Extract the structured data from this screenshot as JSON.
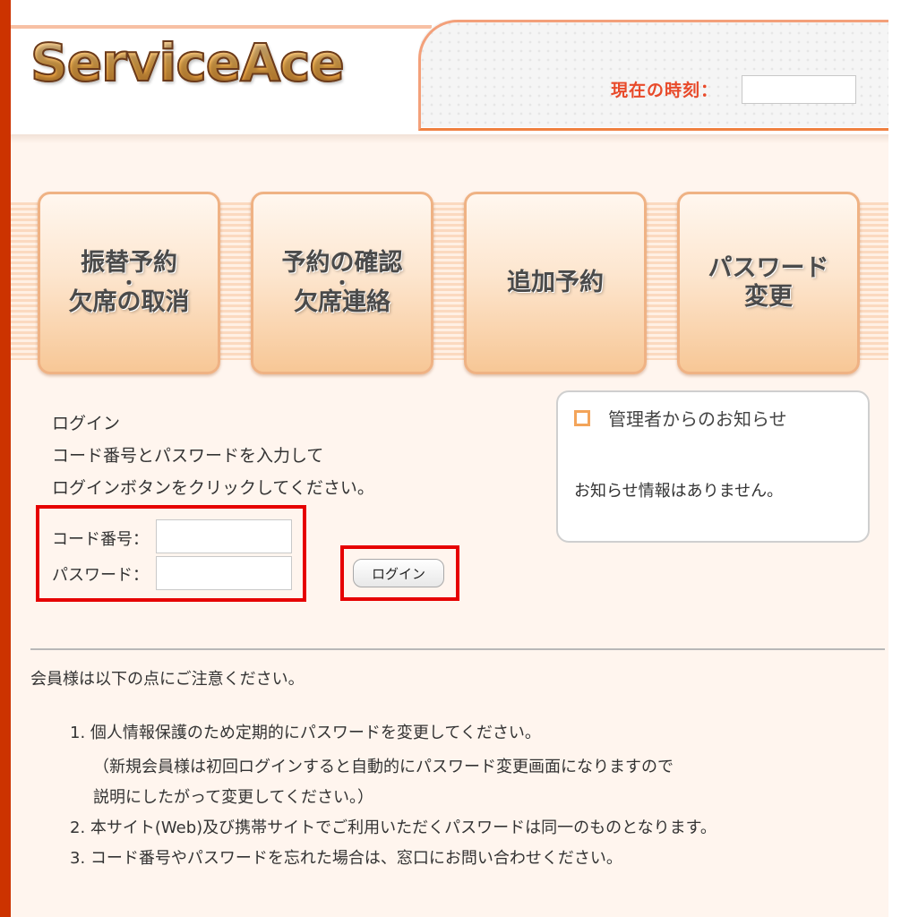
{
  "header": {
    "logo": "ServiceAce",
    "time_label": "現在の時刻：",
    "time_value": ""
  },
  "menu": [
    {
      "line1": "振替予約",
      "line2": "欠席の取消"
    },
    {
      "line1": "予約の確認",
      "line2": "欠席連絡"
    },
    {
      "line1": "追加予約"
    },
    {
      "line1": "パスワード",
      "line2": "変更"
    }
  ],
  "login": {
    "title": "ログイン",
    "instruction1": "コード番号とパスワードを入力して",
    "instruction2": "ログインボタンをクリックしてください。",
    "code_label": "コード番号：",
    "password_label": "パスワード：",
    "code_value": "",
    "password_value": "",
    "button_label": "ログイン"
  },
  "notice": {
    "title": "管理者からのお知らせ",
    "body": "お知らせ情報はありません。"
  },
  "caution": {
    "title": "会員様は以下の点にご注意ください。",
    "items": [
      "1. 個人情報保護のため定期的にパスワードを変更してください。",
      "（新規会員様は初回ログインすると自動的にパスワード変更画面になりますので",
      "説明にしたがって変更してください。）",
      "2. 本サイト(Web)及び携帯サイトでご利用いただくパスワードは同一のものとなります。",
      "3. コード番号やパスワードを忘れた場合は、窓口にお問い合わせください。"
    ]
  },
  "colors": {
    "accent_red": "#cc3300",
    "highlight_red": "#e60000",
    "menu_orange": "#f7c796",
    "page_bg": "#fff5ee"
  }
}
